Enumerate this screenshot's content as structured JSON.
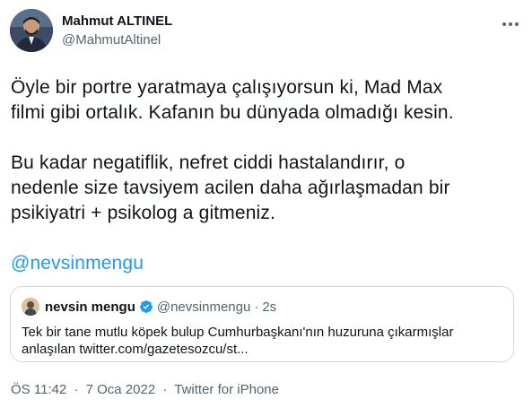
{
  "author": {
    "display_name": "Mahmut ALTINEL",
    "handle": "@MahmutAltinel",
    "avatar_icon": "profile-photo"
  },
  "tweet": {
    "paragraph1": [
      "Öyle bir portre yaratmaya çalışıyorsun ki, Mad Max",
      "filmi gibi ortalık. Kafanın bu dünyada olmadığı kesin."
    ],
    "paragraph2": [
      "Bu kadar negatiflik, nefret ciddi hastalandırır, o",
      "nedenle size tavsiyem acilen daha ağırlaşmadan bir",
      "psikiyatri + psikolog a gitmeniz."
    ],
    "mention": "@nevsinmengu"
  },
  "quoted_tweet": {
    "display_name": "nevsin mengu",
    "verified_icon": "verified-badge-icon",
    "handle": "@nevsinmengu",
    "separator": "·",
    "time": "2s",
    "lines": [
      "Tek bir tane mutlu köpek bulup Cumhurbaşkanı'nın huzuruna çıkarmışlar",
      "anlaşılan twitter.com/gazetesozcu/st..."
    ]
  },
  "meta": {
    "time": "ÖS 11:42",
    "separator": "·",
    "date": "7 Oca 2022",
    "source": "Twitter for iPhone"
  },
  "colors": {
    "link": "#1d9bf0",
    "secondary_text": "#536471",
    "primary_text": "#0f1419",
    "border": "#cfd9de"
  }
}
